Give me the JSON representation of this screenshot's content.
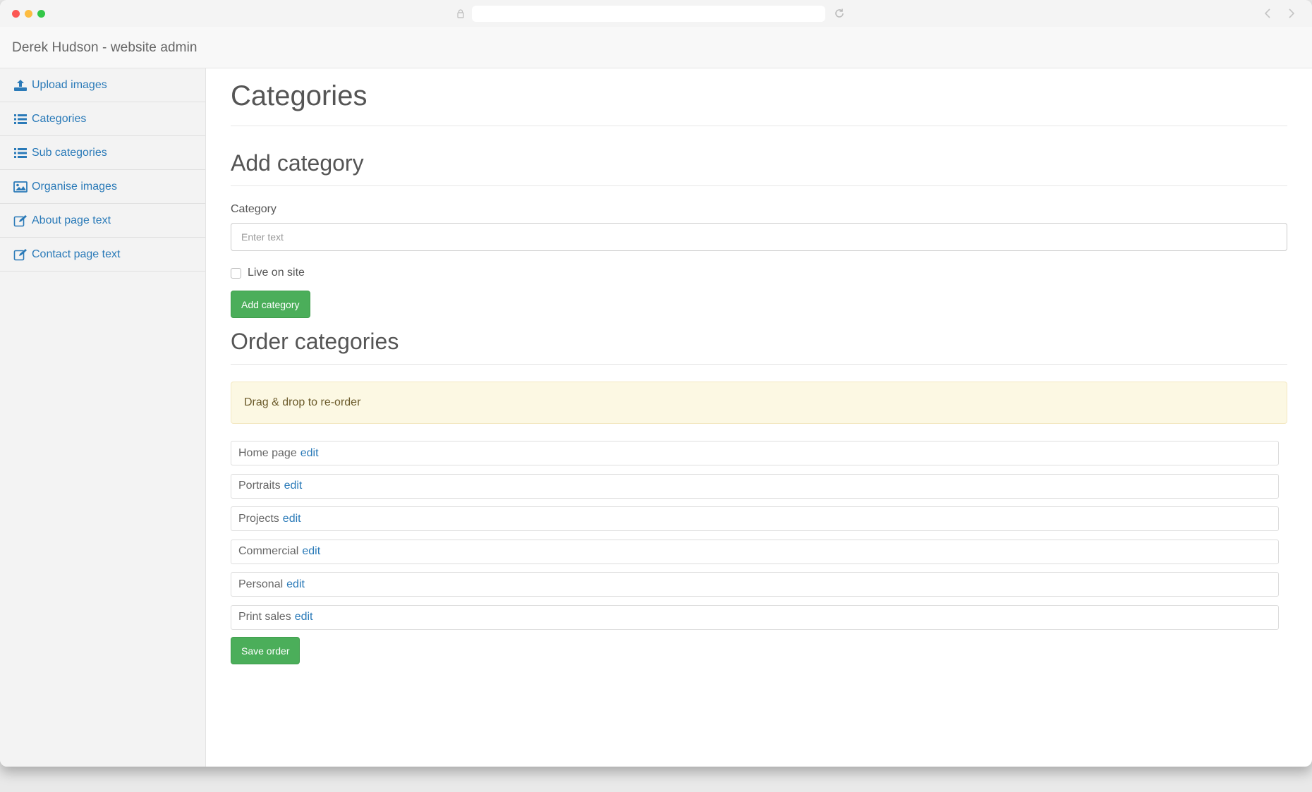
{
  "brand": "Derek Hudson - website admin",
  "sidebar": {
    "items": [
      {
        "label": "Upload images",
        "icon": "upload-icon"
      },
      {
        "label": "Categories",
        "icon": "list-icon"
      },
      {
        "label": "Sub categories",
        "icon": "list-icon"
      },
      {
        "label": "Organise images",
        "icon": "image-icon"
      },
      {
        "label": "About page text",
        "icon": "edit-icon"
      },
      {
        "label": "Contact page text",
        "icon": "edit-icon"
      }
    ]
  },
  "main": {
    "title": "Categories",
    "add_section": {
      "heading": "Add category",
      "field_label": "Category",
      "placeholder": "Enter text",
      "value": "",
      "checkbox_label": "Live on site",
      "checked": false,
      "button_label": "Add category"
    },
    "order_section": {
      "heading": "Order categories",
      "alert": "Drag & drop to re-order",
      "items": [
        {
          "name": "Home page",
          "edit": "edit"
        },
        {
          "name": "Portraits",
          "edit": "edit"
        },
        {
          "name": "Projects",
          "edit": "edit"
        },
        {
          "name": "Commercial",
          "edit": "edit"
        },
        {
          "name": "Personal",
          "edit": "edit"
        },
        {
          "name": "Print sales",
          "edit": "edit"
        }
      ],
      "button_label": "Save order"
    }
  },
  "colors": {
    "link": "#2a7ab8",
    "button": "#4bae5a",
    "alert_bg": "#fcf8e3"
  }
}
